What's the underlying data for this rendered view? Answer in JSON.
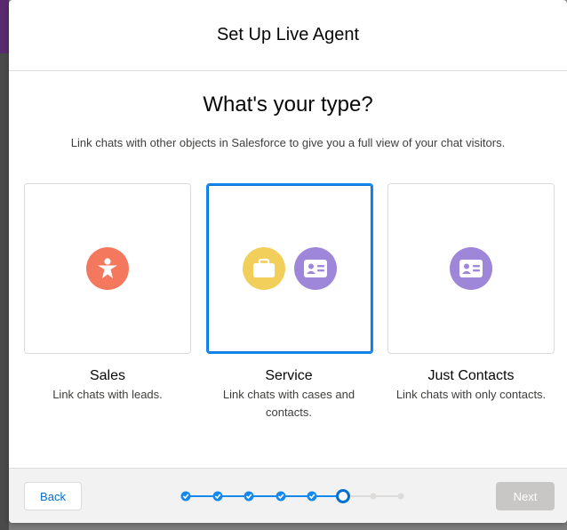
{
  "modal": {
    "title": "Set Up Live Agent"
  },
  "body": {
    "heading": "What's your type?",
    "subheading": "Link chats with other objects in Salesforce to give you a full view of your chat visitors."
  },
  "options": [
    {
      "label": "Sales",
      "description": "Link chats with leads.",
      "icons": [
        "lead-icon"
      ],
      "icon_colors": [
        "#f4785e"
      ],
      "selected": false
    },
    {
      "label": "Service",
      "description": "Link chats with cases and contacts.",
      "icons": [
        "case-icon",
        "contact-icon"
      ],
      "icon_colors": [
        "#f2cf5b",
        "#9e86d8"
      ],
      "selected": true
    },
    {
      "label": "Just Contacts",
      "description": "Link chats with only contacts.",
      "icons": [
        "contact-icon"
      ],
      "icon_colors": [
        "#9e86d8"
      ],
      "selected": false
    }
  ],
  "footer": {
    "back_label": "Back",
    "next_label": "Next",
    "next_disabled": true
  },
  "progress": {
    "total_steps": 8,
    "completed_steps": 5,
    "current_step": 6
  },
  "colors": {
    "brand": "#0070d2",
    "selected_border": "#1589ee",
    "complete_step": "#1589ee",
    "incomplete_step": "#dddbda"
  }
}
